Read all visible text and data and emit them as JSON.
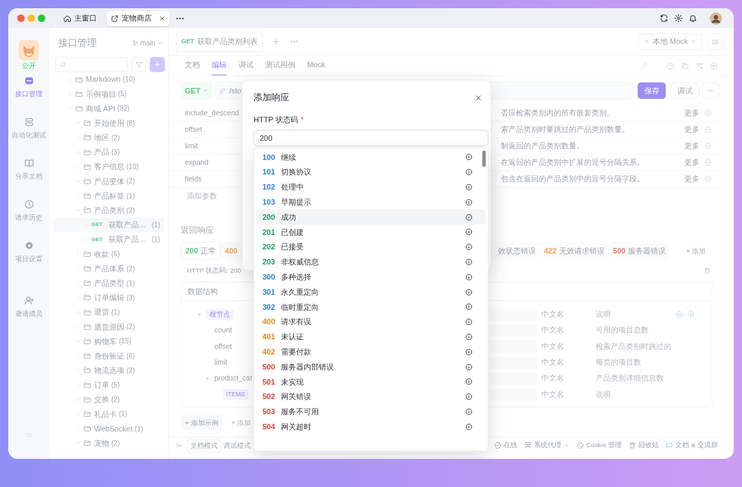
{
  "title_bar": {
    "tabs": [
      {
        "label": "主窗口",
        "selected": false
      },
      {
        "label": "宠物商店",
        "selected": true
      }
    ]
  },
  "nav": {
    "badge": "公开",
    "items": [
      {
        "label": "接口管理",
        "selected": true
      },
      {
        "label": "自动化测试",
        "selected": false
      },
      {
        "label": "分享文档",
        "selected": false
      },
      {
        "label": "请求历史",
        "selected": false
      },
      {
        "label": "项目设置",
        "selected": false
      }
    ],
    "secondary_items": [
      {
        "label": "邀请成员",
        "selected": false
      }
    ]
  },
  "tree": {
    "title": "接口管理",
    "branch": "main",
    "items": [
      {
        "kind": "folder",
        "label": "Markdown",
        "count": "(10)",
        "expanded": false
      },
      {
        "kind": "folder",
        "label": "示例项目",
        "count": "(5)",
        "expanded": false
      },
      {
        "kind": "folder",
        "label": "商城 API",
        "count": "(92)",
        "expanded": true,
        "children": [
          {
            "kind": "folder",
            "label": "开始使用",
            "count": "(8)",
            "expanded": false
          },
          {
            "kind": "folder",
            "label": "地区",
            "count": "(2)",
            "expanded": false
          },
          {
            "kind": "folder",
            "label": "产品",
            "count": "(3)",
            "expanded": false
          },
          {
            "kind": "folder",
            "label": "客户信息",
            "count": "(10)",
            "expanded": false
          },
          {
            "kind": "folder",
            "label": "产品变体",
            "count": "(2)",
            "expanded": false
          },
          {
            "kind": "folder",
            "label": "产品标签",
            "count": "(1)",
            "expanded": false
          },
          {
            "kind": "folder",
            "label": "产品类别",
            "count": "(2)",
            "expanded": true,
            "children": [
              {
                "kind": "endpoint",
                "method": "GET",
                "label": "获取产品...",
                "count": "(1)",
                "selected": true
              },
              {
                "kind": "endpoint",
                "method": "GET",
                "label": "获取产品...",
                "count": "(1)",
                "selected": false
              }
            ]
          },
          {
            "kind": "folder",
            "label": "收款",
            "count": "(6)",
            "expanded": false
          },
          {
            "kind": "folder",
            "label": "产品体系",
            "count": "(2)",
            "expanded": false
          },
          {
            "kind": "folder",
            "label": "产品类型",
            "count": "(1)",
            "expanded": false
          },
          {
            "kind": "folder",
            "label": "订单编辑",
            "count": "(3)",
            "expanded": false
          },
          {
            "kind": "folder",
            "label": "退货",
            "count": "(1)",
            "expanded": false
          },
          {
            "kind": "folder",
            "label": "退货原因",
            "count": "(2)",
            "expanded": false
          },
          {
            "kind": "folder",
            "label": "购物车",
            "count": "(15)",
            "expanded": false
          },
          {
            "kind": "folder",
            "label": "身份验证",
            "count": "(6)",
            "expanded": false
          },
          {
            "kind": "folder",
            "label": "物流选项",
            "count": "(2)",
            "expanded": false
          },
          {
            "kind": "folder",
            "label": "订单",
            "count": "(5)",
            "expanded": false
          },
          {
            "kind": "folder",
            "label": "交换",
            "count": "(2)",
            "expanded": false
          },
          {
            "kind": "folder",
            "label": "礼品卡",
            "count": "(1)",
            "expanded": false
          },
          {
            "kind": "folder",
            "label": "WebSocket",
            "count": "(1)",
            "expanded": false
          },
          {
            "kind": "folder",
            "label": "宠物",
            "count": "(2)",
            "expanded": false
          }
        ]
      }
    ]
  },
  "editor": {
    "tab": {
      "method": "GET",
      "label": "获取产品类别列表"
    },
    "environment": "本地 Mock",
    "subtabs": [
      {
        "label": "文档",
        "selected": false
      },
      {
        "label": "编辑",
        "selected": true
      },
      {
        "label": "调试",
        "selected": false
      },
      {
        "label": "测试用例",
        "selected": false
      },
      {
        "label": "Mock",
        "selected": false
      }
    ],
    "request": {
      "method": "GET",
      "path": "/sto",
      "save": "保存",
      "debug": "调试"
    },
    "params": [
      {
        "name": "include_descend",
        "description": "否应检索类别内的所有嵌套类别。",
        "more": "更多"
      },
      {
        "name": "offset",
        "description": "索产品类别时要跳过的产品类别数量。",
        "more": "更多"
      },
      {
        "name": "limit",
        "description": "制返回的产品类别数量。",
        "more": "更多"
      },
      {
        "name": "expand",
        "description": "在返回的产品类别中扩展的逗号分隔关系。",
        "more": "更多"
      },
      {
        "name": "fields",
        "description": "包含在返回的产品类别中的逗号分隔字段。",
        "more": "更多"
      }
    ],
    "add_param": "添加参数"
  },
  "responses": {
    "title": "返回响应",
    "tabs": [
      {
        "code": "200",
        "label": "正常",
        "color": "#5fc487",
        "selected": true
      },
      {
        "code": "400",
        "color": "#eea657",
        "selected": false
      },
      {
        "label": "效状态错误",
        "selected": false
      },
      {
        "code": "422",
        "label": "无效请求错误",
        "color": "#eea657",
        "selected": false
      },
      {
        "code": "500",
        "label": "服务器错误",
        "color": "#ea7b7b",
        "selected": false
      }
    ],
    "add": "+ 添加",
    "status_label": "HTTP 状态码:",
    "status_value": "200",
    "schema": {
      "title": "数据结构",
      "rows": [
        {
          "kind": "root",
          "name": "根节点",
          "expanded": true,
          "cn": "中文名",
          "desc": "说明",
          "children": [
            {
              "kind": "field",
              "name": "count",
              "cn": "中文名",
              "desc": "可用的项目总数"
            },
            {
              "kind": "field",
              "name": "offset",
              "cn": "中文名",
              "desc": "检索产品类别时跳过的"
            },
            {
              "kind": "field",
              "name": "limit",
              "cn": "中文名",
              "desc": "每页的项目数"
            },
            {
              "kind": "field",
              "name": "product_cat",
              "expanded": true,
              "cn": "中文名",
              "desc": "产品类别详细信息数",
              "children": [
                {
                  "kind": "items",
                  "name": "ITEMS",
                  "cn": "中文名",
                  "desc": "说明"
                }
              ]
            }
          ]
        }
      ]
    },
    "actions": [
      "+ 添加示例",
      "+ 添加"
    ]
  },
  "status_bar": {
    "modes": [
      {
        "label": "文档模式",
        "selected": true
      },
      {
        "label": "调试模式",
        "selected": false
      }
    ],
    "items": [
      {
        "kind": "button",
        "label": "在线"
      },
      {
        "kind": "dropdown",
        "label": "系统代理"
      },
      {
        "kind": "button",
        "label": "Cookie 管理"
      },
      {
        "kind": "button",
        "label": "回收站"
      },
      {
        "kind": "button",
        "label": "文档 & 交流群"
      }
    ]
  },
  "dialog": {
    "title": "添加响应",
    "field_label": "HTTP 状态码",
    "required_mark": "*",
    "value": "200",
    "options": [
      {
        "code": "100",
        "label": "继续",
        "color": "#2f80d8",
        "selected": false
      },
      {
        "code": "101",
        "label": "切换协议",
        "color": "#2f80d8",
        "selected": false
      },
      {
        "code": "102",
        "label": "处理中",
        "color": "#2f80d8",
        "selected": false
      },
      {
        "code": "103",
        "label": "早期提示",
        "color": "#2f80d8",
        "selected": false
      },
      {
        "code": "200",
        "label": "成功",
        "color": "#1f9d55",
        "selected": true
      },
      {
        "code": "201",
        "label": "已创建",
        "color": "#1f9d55",
        "selected": false
      },
      {
        "code": "202",
        "label": "已接受",
        "color": "#1f9d55",
        "selected": false
      },
      {
        "code": "203",
        "label": "非权威信息",
        "color": "#1f9d55",
        "selected": false
      },
      {
        "code": "300",
        "label": "多种选择",
        "color": "#2f80d8",
        "selected": false
      },
      {
        "code": "301",
        "label": "永久重定向",
        "color": "#2f80d8",
        "selected": false
      },
      {
        "code": "302",
        "label": "临时重定向",
        "color": "#2f80d8",
        "selected": false
      },
      {
        "code": "400",
        "label": "请求有误",
        "color": "#e08a1e",
        "selected": false
      },
      {
        "code": "401",
        "label": "未认证",
        "color": "#e08a1e",
        "selected": false
      },
      {
        "code": "402",
        "label": "需要付款",
        "color": "#e08a1e",
        "selected": false
      },
      {
        "code": "500",
        "label": "服务器内部错误",
        "color": "#d9463b",
        "selected": false
      },
      {
        "code": "501",
        "label": "未实现",
        "color": "#d9463b",
        "selected": false
      },
      {
        "code": "502",
        "label": "网关错误",
        "color": "#d9463b",
        "selected": false
      },
      {
        "code": "503",
        "label": "服务不可用",
        "color": "#d9463b",
        "selected": false
      },
      {
        "code": "504",
        "label": "网关超时",
        "color": "#d9463b",
        "selected": false
      }
    ]
  }
}
